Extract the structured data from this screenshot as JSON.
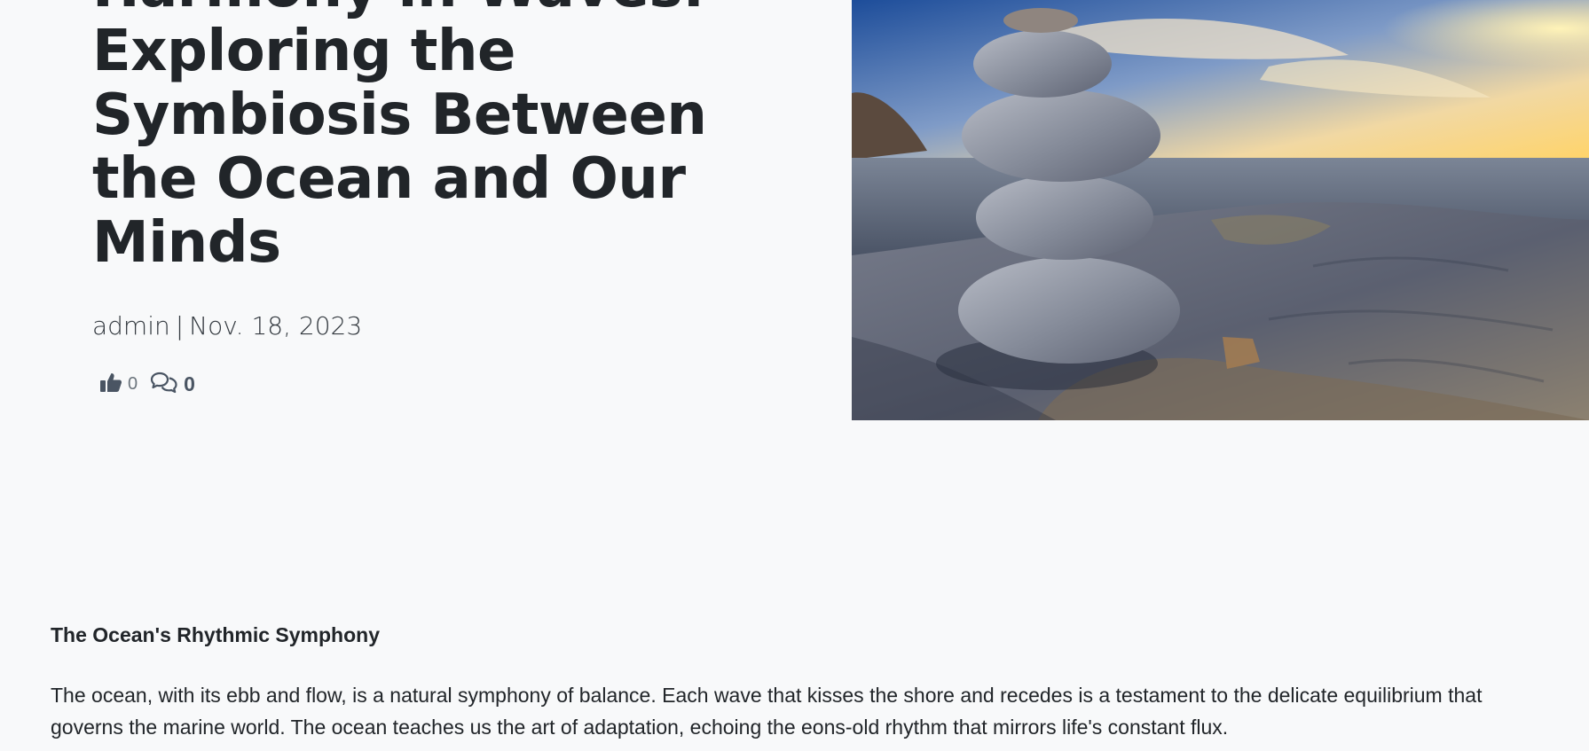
{
  "article": {
    "title": "Harmony in Waves: Exploring the Symbiosis Between the Ocean and Our Minds",
    "author": "admin",
    "separator": "|",
    "date": "Nov. 18, 2023",
    "likes": "0",
    "comments": "0"
  },
  "icons": {
    "like": "thumbs-up-icon",
    "comment": "comments-icon"
  },
  "hero_image": {
    "subject": "stacked stones on a rocky shore at sunset"
  },
  "section": {
    "heading": "The Ocean's Rhythmic Symphony",
    "paragraph": "The ocean, with its ebb and flow, is a natural symphony of balance. Each wave that kisses the shore and recedes is a testament to the delicate equilibrium that governs the marine world. The ocean teaches us the art of adaptation, echoing the eons-old rhythm that mirrors life's constant flux."
  },
  "colors": {
    "background": "#f8f9fa",
    "text": "#212529",
    "icon": "#4a5563"
  }
}
